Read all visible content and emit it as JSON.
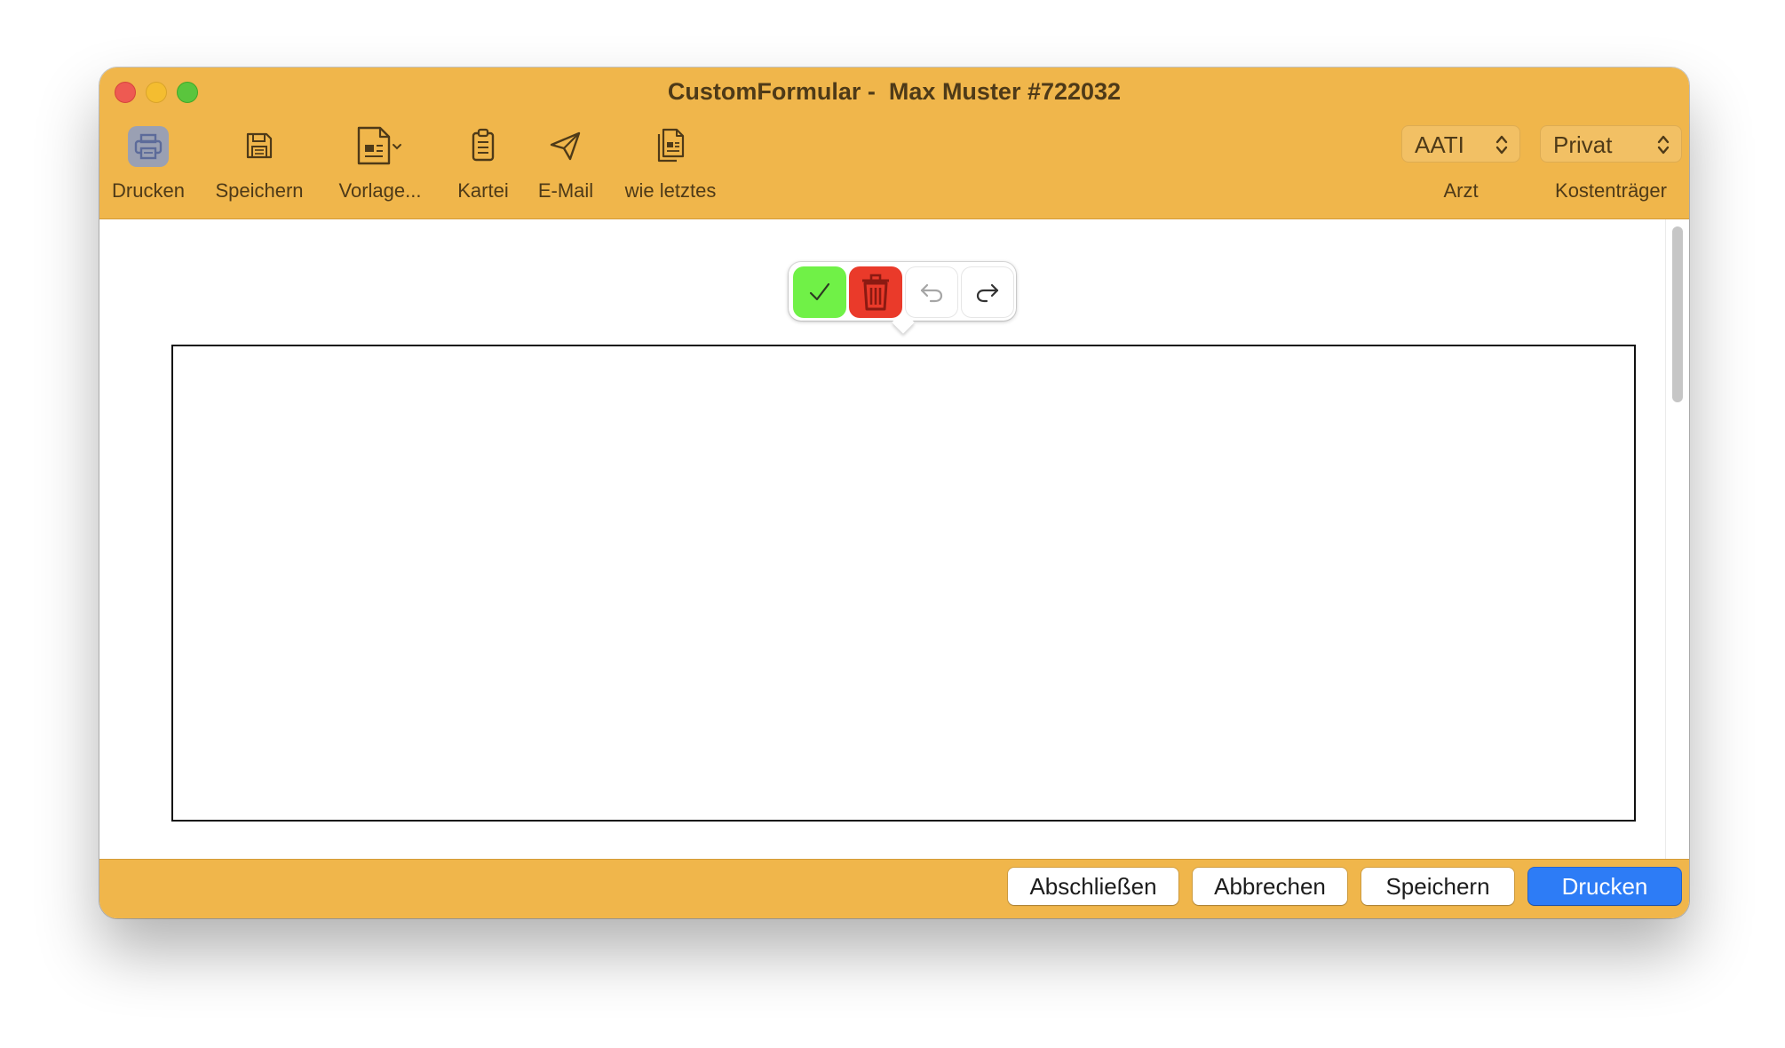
{
  "window": {
    "title": "CustomFormular -  Max Muster #722032"
  },
  "toolbar": {
    "items": [
      {
        "label": "Drucken",
        "icon": "printer-icon"
      },
      {
        "label": "Speichern",
        "icon": "floppy-disk-icon"
      },
      {
        "label": "Vorlage...",
        "icon": "template-document-icon"
      },
      {
        "label": "Kartei",
        "icon": "clipboard-icon"
      },
      {
        "label": "E-Mail",
        "icon": "paper-plane-icon"
      },
      {
        "label": "wie letztes",
        "icon": "copy-document-icon"
      }
    ],
    "arzt": {
      "value": "AATI",
      "caption": "Arzt"
    },
    "kostentraeger": {
      "value": "Privat",
      "caption": "Kostenträger"
    }
  },
  "signature_toolbar": {
    "buttons": [
      {
        "name": "confirm",
        "icon": "checkmark-icon",
        "color": "#70f147"
      },
      {
        "name": "delete",
        "icon": "trash-icon",
        "color": "#ea3a2a"
      },
      {
        "name": "undo",
        "icon": "undo-arrow-icon"
      },
      {
        "name": "redo",
        "icon": "redo-arrow-icon"
      }
    ]
  },
  "footer": {
    "buttons": {
      "abschliessen": "Abschließen",
      "abbrechen": "Abbrechen",
      "speichern": "Speichern",
      "drucken": "Drucken"
    }
  },
  "colors": {
    "chrome": "#f0b64b",
    "primary_button": "#2d7cf6",
    "confirm": "#70f147",
    "delete": "#ea3a2a"
  }
}
